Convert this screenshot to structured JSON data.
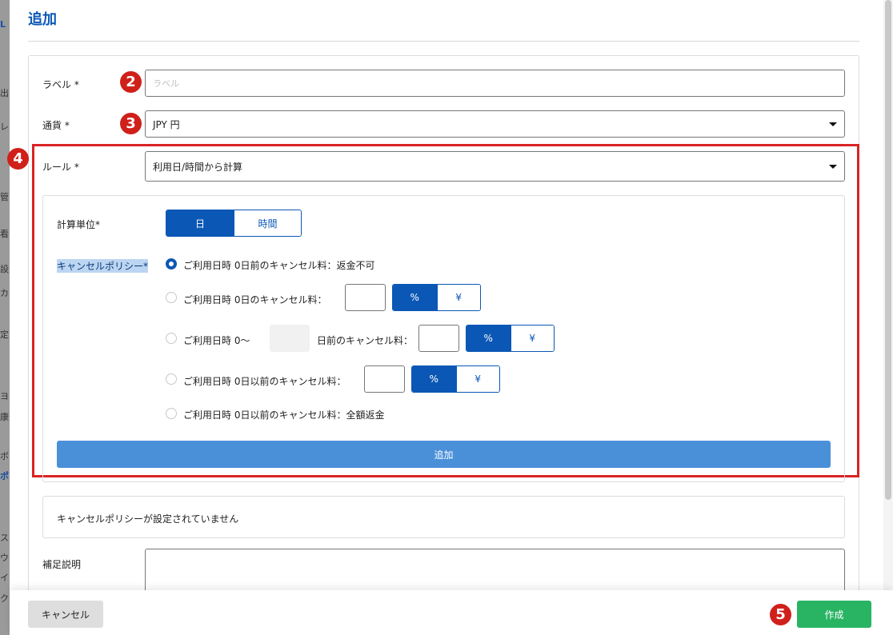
{
  "background_strip": {
    "chars": [
      {
        "text": "L",
        "blue": true
      },
      {
        "text": "出",
        "blue": false
      },
      {
        "text": "レ",
        "blue": false
      },
      {
        "text": "管",
        "blue": false
      },
      {
        "text": "看",
        "blue": false
      },
      {
        "text": "設",
        "blue": false
      },
      {
        "text": "カ",
        "blue": false
      },
      {
        "text": "定",
        "blue": false
      },
      {
        "text": "ヨ",
        "blue": false
      },
      {
        "text": "康",
        "blue": false
      },
      {
        "text": "ボ",
        "blue": false
      },
      {
        "text": "ポ",
        "blue": true
      },
      {
        "text": "ス",
        "blue": false
      },
      {
        "text": "ウ",
        "blue": false
      },
      {
        "text": "イ",
        "blue": false
      },
      {
        "text": "ク",
        "blue": false
      }
    ]
  },
  "modal": {
    "title": "追加"
  },
  "form": {
    "label_field": {
      "label": "ラベル *",
      "placeholder": "ラベル",
      "value": ""
    },
    "currency_field": {
      "label": "通貨 *",
      "value": "JPY 円"
    },
    "rule_field": {
      "label": "ルール *",
      "value": "利用日/時間から計算"
    }
  },
  "calc_unit": {
    "label": "計算単位*",
    "options": [
      "日",
      "時間"
    ],
    "selected": "日"
  },
  "cancel_policy": {
    "label": "キャンセルポリシー*",
    "options": [
      {
        "text": "ご利用日時 0日前のキャンセル料：返金不可",
        "checked": true
      },
      {
        "text": "ご利用日時 0日のキャンセル料：",
        "checked": false,
        "unit_toggle": [
          "%",
          "¥"
        ],
        "selected_unit": "%",
        "amount": ""
      },
      {
        "text": "ご利用日時 0〜",
        "suffix": "日前のキャンセル料：",
        "checked": false,
        "unit_toggle": [
          "%",
          "¥"
        ],
        "selected_unit": "%",
        "amount": ""
      },
      {
        "text": "ご利用日時 0日以前のキャンセル料：",
        "checked": false,
        "unit_toggle": [
          "%",
          "¥"
        ],
        "selected_unit": "%",
        "amount": ""
      },
      {
        "text": "ご利用日時 0日以前のキャンセル料：全額返金",
        "checked": false
      }
    ],
    "add_button": "追加"
  },
  "notice": {
    "text": "キャンセルポリシーが設定されていません"
  },
  "supplement": {
    "label": "補足説明",
    "value": ""
  },
  "footer": {
    "cancel_label": "キャンセル",
    "create_label": "作成"
  },
  "annotations": {
    "markers": [
      "2",
      "3",
      "4",
      "5"
    ],
    "box_color": "#d92323"
  },
  "colors": {
    "primary": "#0b57b5",
    "add_button": "#4a90d9",
    "create_button": "#28b463",
    "marker": "#d0201a"
  }
}
